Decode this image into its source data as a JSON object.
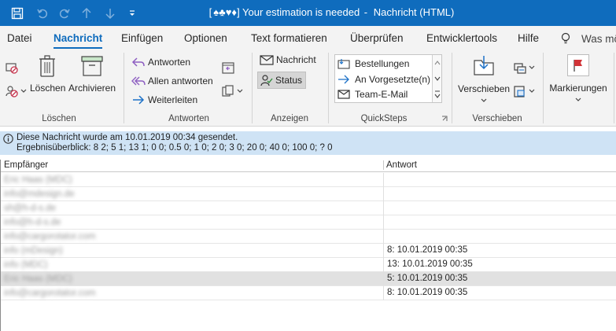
{
  "titlebar": {
    "title_prefix": "[",
    "suits": "♠♣♥♦",
    "title_main": "] Your estimation is needed",
    "title_sep": "-",
    "title_suffix": "Nachricht (HTML)",
    "bg": "#0f6cbd"
  },
  "tabs": [
    "Datei",
    "Nachricht",
    "Einfügen",
    "Optionen",
    "Text formatieren",
    "Überprüfen",
    "Entwicklertools",
    "Hilfe",
    "Was mö"
  ],
  "ribbon": {
    "loeschen": {
      "delete_label": "Löschen",
      "archive_label": "Archivieren",
      "group": "Löschen"
    },
    "antworten": {
      "reply": "Antworten",
      "reply_all": "Allen antworten",
      "forward": "Weiterleiten",
      "group": "Antworten"
    },
    "anzeigen": {
      "message": "Nachricht",
      "status": "Status",
      "group": "Anzeigen"
    },
    "quicksteps": {
      "items": [
        "Bestellungen",
        "An Vorgesetzte(n)",
        "Team-E-Mail"
      ],
      "group": "QuickSteps"
    },
    "verschieben": {
      "move": "Verschieben",
      "group": "Verschieben"
    },
    "markierungen": {
      "label": "Markierungen"
    }
  },
  "infobar": {
    "line1": "Diese Nachricht wurde am 10.01.2019 00:34 gesendet.",
    "line2": "Ergebnisüberblick: 8 2; 5 1; 13 1; 0 0; 0.5 0; 1 0; 2 0; 3 0; 20 0; 40 0; 100 0; ? 0"
  },
  "table": {
    "headers": [
      "Empfänger",
      "Antwort"
    ],
    "rows": [
      {
        "recipient": "Eric Haas (MDC)",
        "answer": ""
      },
      {
        "recipient": "info@mdesign.de",
        "answer": ""
      },
      {
        "recipient": "sh@h-d-s.de",
        "answer": ""
      },
      {
        "recipient": "info@h-d-s.de",
        "answer": ""
      },
      {
        "recipient": "info@cargorotator.com",
        "answer": ""
      },
      {
        "recipient": "info (mDesign)",
        "answer": "8: 10.01.2019 00:35"
      },
      {
        "recipient": "info (MDC)",
        "answer": "13: 10.01.2019 00:35"
      },
      {
        "recipient": "Eric Haas (MDC)",
        "answer": "5: 10.01.2019 00:35"
      },
      {
        "recipient": "info@cargorotator.com",
        "answer": "8: 10.01.2019 00:35"
      }
    ]
  }
}
